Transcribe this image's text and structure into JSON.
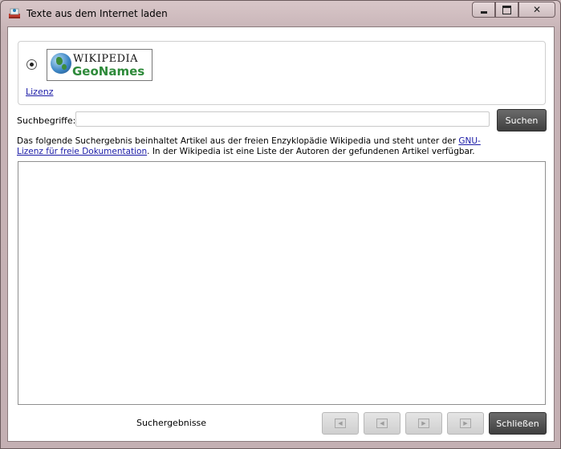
{
  "window": {
    "title": "Texte aus dem Internet laden",
    "minimize_icon": "minimize-icon",
    "maximize_icon": "maximize-icon",
    "close_icon": "close-icon"
  },
  "provider": {
    "logo_line1": "WIKIPEDIA",
    "logo_line2": "GeoNames",
    "license_link": "Lizenz",
    "selected": true
  },
  "search": {
    "label": "Suchbegriffe:",
    "value": "",
    "placeholder": "",
    "button_label": "Suchen"
  },
  "notice": {
    "text_before_link": "Das folgende Suchergebnis beinhaltet Artikel aus der freien Enzyklopädie Wikipedia und steht unter der ",
    "link_text_line1": "GNU-",
    "link_text_line2": "Lizenz für freie Dokumentation",
    "text_after_link": ". In der Wikipedia ist eine Liste der Autoren der gefundenen Artikel verfügbar."
  },
  "results": {
    "label": "Suchergebnisse"
  },
  "footer": {
    "nav_buttons": [
      "first-page-icon",
      "previous-page-icon",
      "next-page-icon",
      "last-page-icon"
    ],
    "close_label": "Schließen"
  },
  "colors": {
    "link": "#1a1aa6",
    "dark_button": "#4a4a4a",
    "logo_green": "#2e8a3a"
  }
}
